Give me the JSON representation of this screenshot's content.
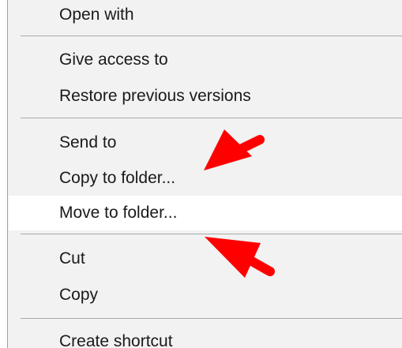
{
  "menu": {
    "items": [
      {
        "label": "Open with",
        "highlighted": false
      },
      {
        "label": "Give access to",
        "highlighted": false
      },
      {
        "label": "Restore previous versions",
        "highlighted": false
      },
      {
        "label": "Send to",
        "highlighted": false
      },
      {
        "label": "Copy to folder...",
        "highlighted": false
      },
      {
        "label": "Move to folder...",
        "highlighted": true
      },
      {
        "label": "Cut",
        "highlighted": false
      },
      {
        "label": "Copy",
        "highlighted": false
      },
      {
        "label": "Create shortcut",
        "highlighted": false
      }
    ]
  },
  "colors": {
    "menu_background": "#f2f2f2",
    "highlight_background": "#ffffff",
    "separator": "#a9a9a9",
    "annotation_arrow": "#ff0000"
  },
  "annotations": [
    {
      "icon": "red-arrow-icon",
      "points_to": "Copy to folder..."
    },
    {
      "icon": "red-arrow-icon",
      "points_to": "Move to folder..."
    }
  ]
}
